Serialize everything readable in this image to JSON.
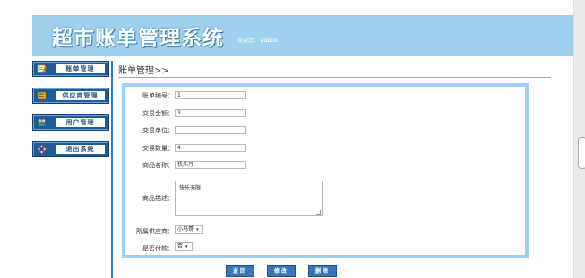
{
  "header": {
    "app_title": "超市账单管理系统",
    "welcome_prefix": "欢迎您：",
    "username": "admin"
  },
  "sidebar": {
    "items": [
      {
        "label": "账单管理",
        "icon": "notepad-icon"
      },
      {
        "label": "供应商管理",
        "icon": "book-icon"
      },
      {
        "label": "用户管理",
        "icon": "users-icon"
      },
      {
        "label": "退出系统",
        "icon": "lifebuoy-icon"
      }
    ]
  },
  "main": {
    "page_title": "账单管理>>"
  },
  "form": {
    "bill_code_label": "账单编号：",
    "bill_code_value": "1",
    "amount_label": "交易金额：",
    "amount_value": "3",
    "unit_label": "交易单位：",
    "unit_value": "",
    "quantity_label": "交易数量：",
    "quantity_value": "4",
    "product_name_label": "商品名称：",
    "product_name_value": "快乐丹",
    "product_desc_label": "商品描述：",
    "product_desc_value": "快乐无限",
    "provider_label": "所属供应商：",
    "provider_value": "小马哥",
    "paid_label": "是否付款：",
    "paid_value": "否"
  },
  "buttons": {
    "back": "返回",
    "modify": "修改",
    "delete": "删除"
  },
  "colors": {
    "header_bg": "#9fd0ee",
    "sidebar_button": "#1d5b9b",
    "action_button": "#3a73b8",
    "divider": "#2a76c2"
  }
}
